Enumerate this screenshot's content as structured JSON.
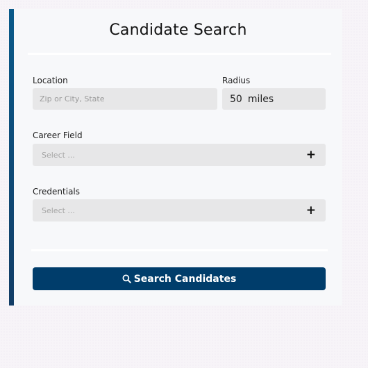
{
  "form": {
    "title": "Candidate Search",
    "location": {
      "label": "Location",
      "placeholder": "Zip or City, State",
      "value": ""
    },
    "radius": {
      "label": "Radius",
      "value": "50",
      "unit": "miles"
    },
    "career_field": {
      "label": "Career Field",
      "placeholder": "Select ...",
      "icon": "plus-icon"
    },
    "credentials": {
      "label": "Credentials",
      "placeholder": "Select ...",
      "icon": "plus-icon"
    },
    "search_button": {
      "label": "Search Candidates",
      "icon": "search-icon"
    }
  },
  "colors": {
    "accent": "#003d6b",
    "panel_background": "#f7f8fa",
    "field_background": "#e7e7e8"
  }
}
